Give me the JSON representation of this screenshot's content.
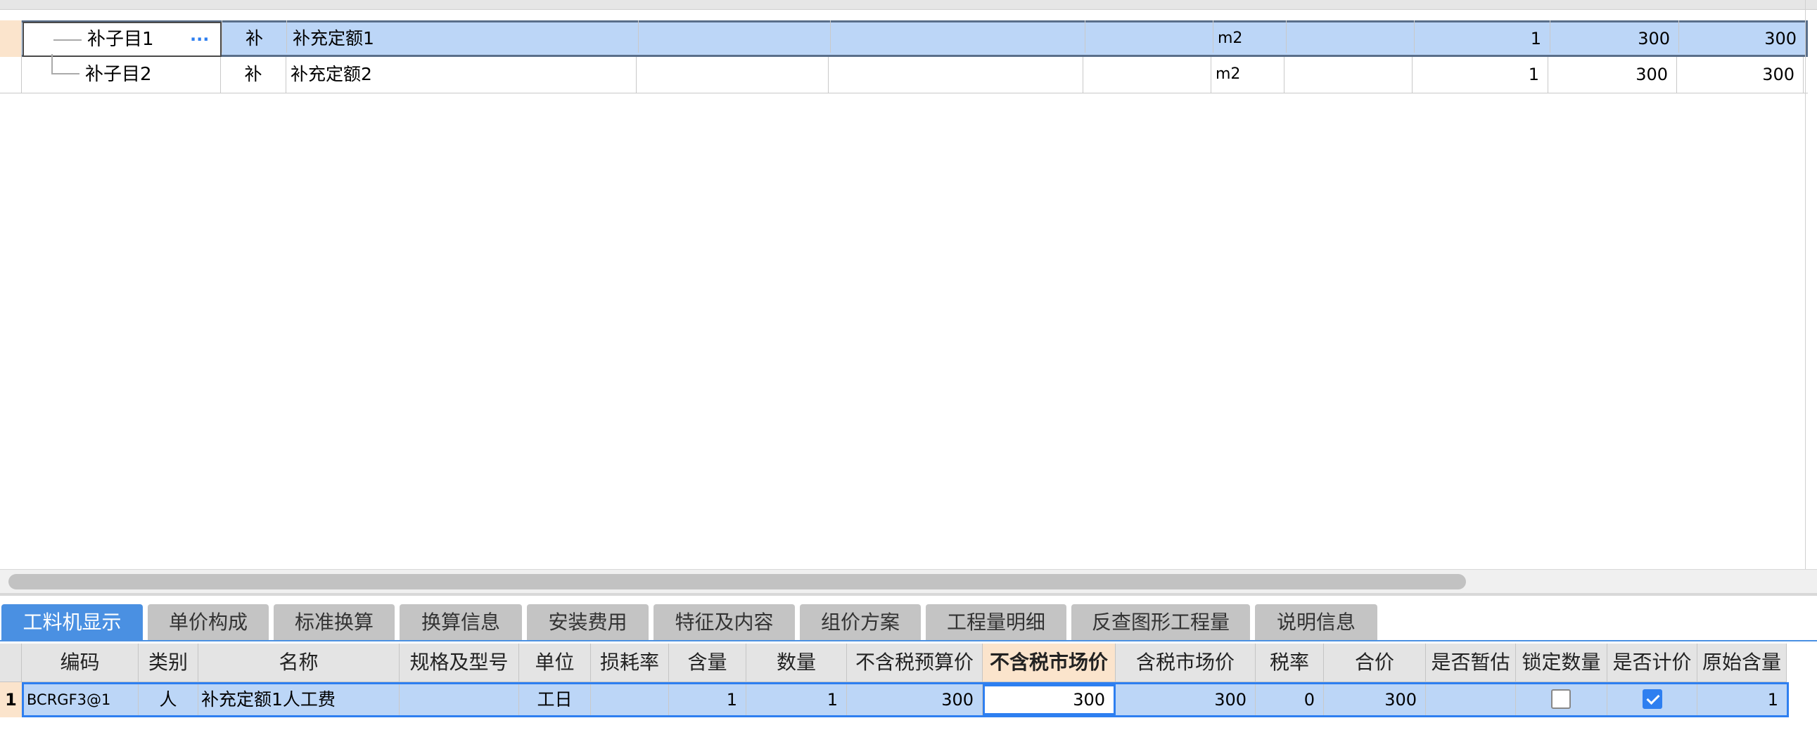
{
  "top_grid": {
    "rows": [
      {
        "code": "补子目1",
        "more": "···",
        "type": "补",
        "name": "补充定额1",
        "unit": "m2",
        "qty": "1",
        "price": "300",
        "total": "300"
      },
      {
        "code": "补子目2",
        "type": "补",
        "name": "补充定额2",
        "unit": "m2",
        "qty": "1",
        "price": "300",
        "total": "300"
      }
    ]
  },
  "tabs": [
    "工料机显示",
    "单价构成",
    "标准换算",
    "换算信息",
    "安装费用",
    "特征及内容",
    "组价方案",
    "工程量明细",
    "反查图形工程量",
    "说明信息"
  ],
  "bottom_grid": {
    "headers": [
      "编码",
      "类别",
      "名称",
      "规格及型号",
      "单位",
      "损耗率",
      "含量",
      "数量",
      "不含税预算价",
      "不含税市场价",
      "含税市场价",
      "税率",
      "合价",
      "是否暂估",
      "锁定数量",
      "是否计价",
      "原始含量"
    ],
    "row": {
      "index": "1",
      "code": "BCRGF3@1",
      "type": "人",
      "name": "补充定额1人工费",
      "spec": "",
      "unit": "工日",
      "loss": "",
      "content": "1",
      "qty": "1",
      "budget_price": "300",
      "market_price": "300",
      "tax_market_price": "300",
      "tax_rate": "0",
      "total": "300",
      "is_provisional": "",
      "lock_qty": false,
      "is_priced": true,
      "original_content": "1"
    }
  }
}
